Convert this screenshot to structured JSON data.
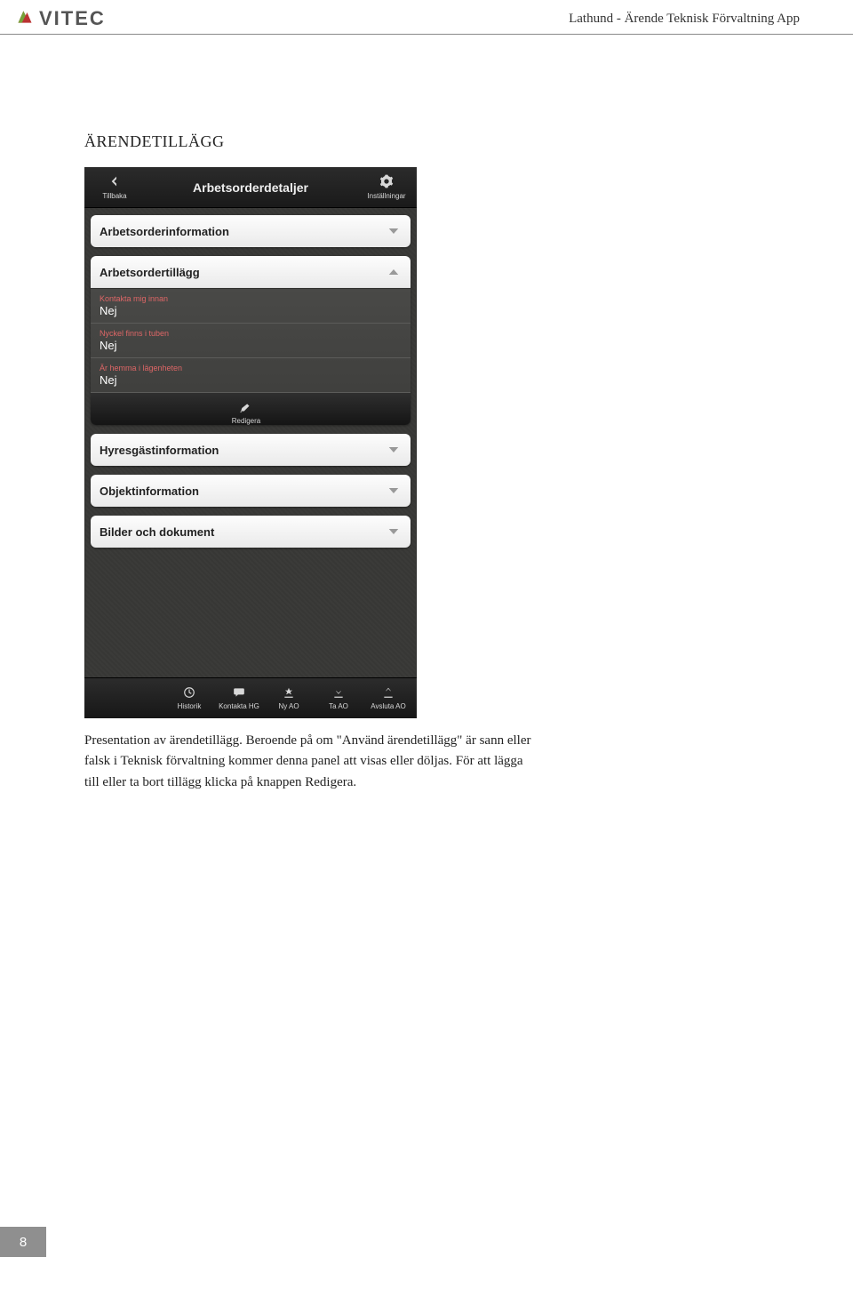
{
  "header": {
    "brand": "VITEC",
    "doc_title": "Lathund - Ärende Teknisk Förvaltning App"
  },
  "section_heading": "ÄRENDETILLÄGG",
  "phone": {
    "topbar": {
      "back_label": "Tillbaka",
      "title": "Arbetsorderdetaljer",
      "settings_label": "Inställningar"
    },
    "sections": {
      "arbetsorderinfo": "Arbetsorderinformation",
      "arbetsordertillagg": "Arbetsordertillägg",
      "hyresgast": "Hyresgästinformation",
      "objekt": "Objektinformation",
      "bilder": "Bilder och dokument"
    },
    "fields": {
      "kontakta": {
        "label": "Kontakta mig innan",
        "value": "Nej"
      },
      "nyckel": {
        "label": "Nyckel finns i tuben",
        "value": "Nej"
      },
      "hemma": {
        "label": "Är hemma i lägenheten",
        "value": "Nej"
      }
    },
    "edit_label": "Redigera",
    "bottombar": {
      "historik": "Historik",
      "kontakta": "Kontakta HG",
      "nyao": "Ny AO",
      "taao": "Ta AO",
      "avsluta": "Avsluta AO"
    }
  },
  "body_text": "Presentation av ärendetillägg. Beroende på om \"Använd ärendetillägg\" är sann eller falsk i Teknisk förvaltning kommer denna panel att visas eller döljas. För att lägga till eller ta bort tillägg klicka på knappen Redigera.",
  "page_number": "8"
}
